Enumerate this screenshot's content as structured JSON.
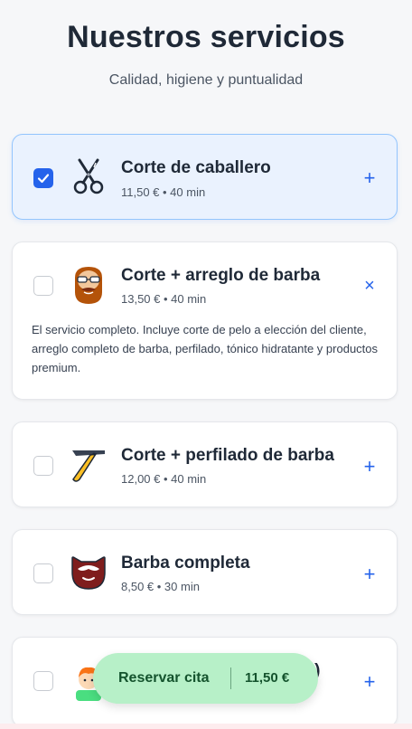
{
  "header": {
    "title": "Nuestros servicios",
    "subtitle": "Calidad, higiene y puntualidad"
  },
  "services": [
    {
      "name": "Corte de caballero",
      "meta": "11,50 € • 40 min",
      "icon": "scissors-icon",
      "selected": true,
      "expanded": false,
      "toggle": "+"
    },
    {
      "name": "Corte + arreglo de barba",
      "meta": "13,50 € • 40 min",
      "icon": "bearded-man-icon",
      "selected": false,
      "expanded": true,
      "toggle": "×",
      "description": "El servicio completo. Incluye corte de pelo a elección del cliente, arreglo completo de barba, perfilado, tónico hidratante y productos premium."
    },
    {
      "name": "Corte + perfilado de barba",
      "meta": "12,00 € • 40 min",
      "icon": "straight-razor-icon",
      "selected": false,
      "expanded": false,
      "toggle": "+"
    },
    {
      "name": "Barba completa",
      "meta": "8,50 € • 30 min",
      "icon": "beard-mustache-icon",
      "selected": false,
      "expanded": false,
      "toggle": "+"
    },
    {
      "name": "os)",
      "meta": "",
      "icon": "child-icon",
      "selected": false,
      "expanded": false,
      "toggle": "+"
    }
  ],
  "booking": {
    "label": "Reservar cita",
    "price": "11,50 €"
  },
  "colors": {
    "accent": "#2563eb",
    "selected_bg": "#eaf2fe",
    "booking_bg": "#b7f0c8"
  }
}
